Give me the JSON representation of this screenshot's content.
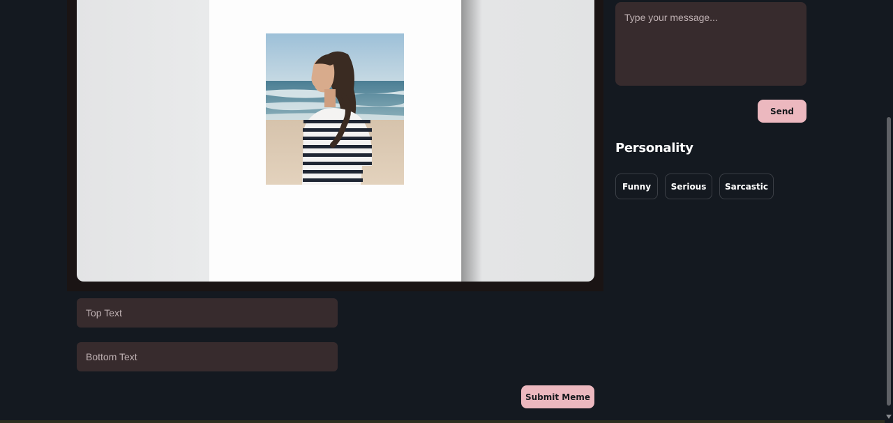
{
  "meme": {
    "top_text_placeholder": "Top Text",
    "bottom_text_placeholder": "Bottom Text",
    "submit_label": "Submit Meme"
  },
  "chat": {
    "message_placeholder": "Type your message...",
    "send_label": "Send"
  },
  "personality": {
    "title": "Personality",
    "options": [
      "Funny",
      "Serious",
      "Sarcastic"
    ]
  },
  "colors": {
    "background": "#141920",
    "input_background": "#372b2d",
    "accent_pink": "#ecb8bf"
  }
}
